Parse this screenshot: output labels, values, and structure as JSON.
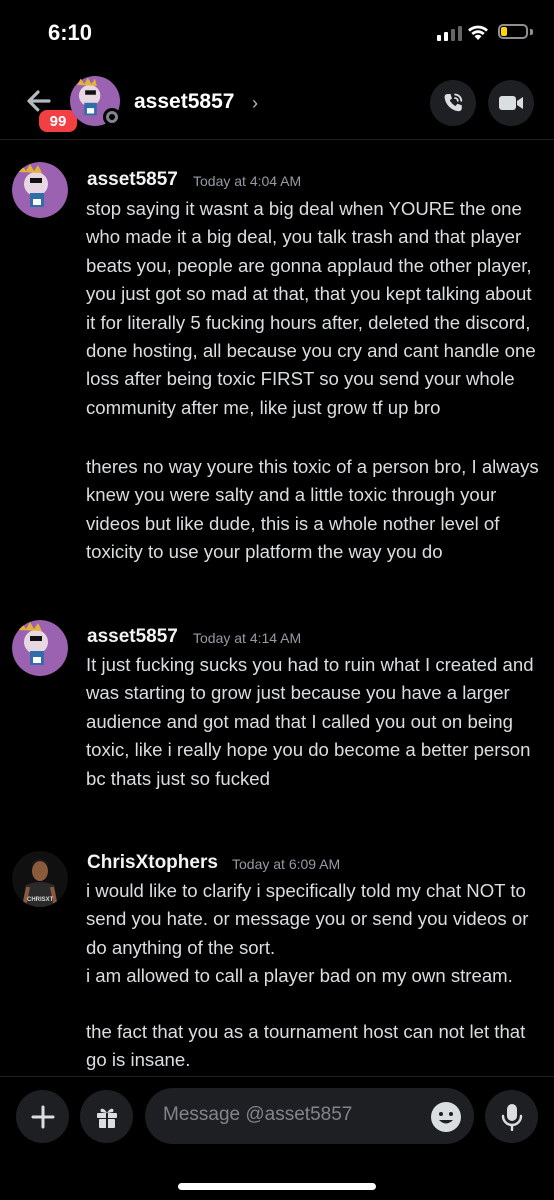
{
  "status_bar": {
    "time": "6:10"
  },
  "header": {
    "unread_badge": "99",
    "channel_name": "asset5857",
    "chevron": "›",
    "call_icon": "phone-call-icon",
    "video_icon": "video-camera-icon"
  },
  "messages": [
    {
      "author": "asset5857",
      "timestamp": "Today at 4:04 AM",
      "paragraphs": [
        "stop saying it wasnt a big deal when YOURE the one who made it a big deal, you talk trash and that player beats you, people are gonna applaud the other player, you just got so mad at that, that you kept talking about it for literally 5 fucking hours after, deleted the discord, done hosting, all because you cry and cant handle one loss after being toxic FIRST so you send your whole community after me, like just grow tf up bro",
        "theres no way youre this toxic of a person bro, I always knew you were salty and a little toxic through your videos but like dude, this is a whole nother level of toxicity to use your platform the way you do"
      ]
    },
    {
      "author": "asset5857",
      "timestamp": "Today at 4:14 AM",
      "paragraphs": [
        "It just fucking sucks you had to ruin what I created and was starting to grow just because you have a larger audience and got mad that I called you out on being toxic, like i really hope you do become a better person bc thats just so fucked"
      ]
    },
    {
      "author": "ChrisXtophers",
      "timestamp": "Today at 6:09 AM",
      "paragraphs": [
        "i would like to clarify i specifically told my chat NOT to send you hate. or message you or send you videos or do anything of the sort.",
        "i am allowed to call a player bad on my own stream.",
        "the fact that you as a tournament host can not let that go is insane."
      ],
      "avatar_shirt_text": "CHRISXT"
    }
  ],
  "composer": {
    "placeholder": "Message @asset5857"
  },
  "colors": {
    "background": "#000000",
    "badge": "#f23f43",
    "surface": "#1e1f22",
    "battery": "#ffd60a",
    "timestamp": "#949ba4",
    "message_text": "#dbdee1"
  }
}
